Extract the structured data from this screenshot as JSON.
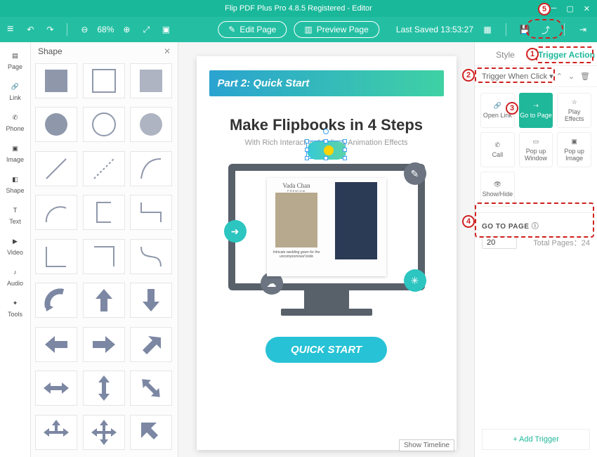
{
  "titlebar": {
    "title": "Flip PDF Plus Pro 4.8.5 Registered - Editor"
  },
  "toolbar": {
    "zoom": "68%",
    "edit_page": "Edit Page",
    "preview_page": "Preview Page",
    "last_saved": "Last Saved 13:53:27"
  },
  "leftrail": {
    "items": [
      "Page",
      "Link",
      "Phone",
      "Image",
      "Shape",
      "Text",
      "Video",
      "Audio",
      "Tools"
    ]
  },
  "shapepanel": {
    "title": "Shape"
  },
  "page_content": {
    "banner": "Part 2: Quick Start",
    "heading": "Make Flipbooks in 4 Steps",
    "sub": "With Rich Interactive Media & Animation Effects",
    "brand": "Vada Chan",
    "brand_sub": "PREMIUM",
    "caption": "Intricate wedding gown for the uncompromised bride",
    "quick_start": "QUICK START"
  },
  "show_timeline": "Show Timeline",
  "rightpanel": {
    "tab_style": "Style",
    "tab_trigger": "Trigger Action",
    "trigger_when": "Trigger When Click",
    "actions": {
      "open_link": "Open Link",
      "go_to_page": "Go to Page",
      "play_effects": "Play Effects",
      "call": "Call",
      "popup_window": "Pop up Window",
      "popup_image": "Pop up Image",
      "show_hide": "Show/Hide"
    },
    "goto_label": "GO TO PAGE",
    "goto_value": "20",
    "total_pages_label": "Total Pages：",
    "total_pages": "24",
    "add_trigger": "+ Add Trigger"
  },
  "callouts": {
    "c1": "1",
    "c2": "2",
    "c3": "3",
    "c4": "4",
    "c5": "5"
  }
}
